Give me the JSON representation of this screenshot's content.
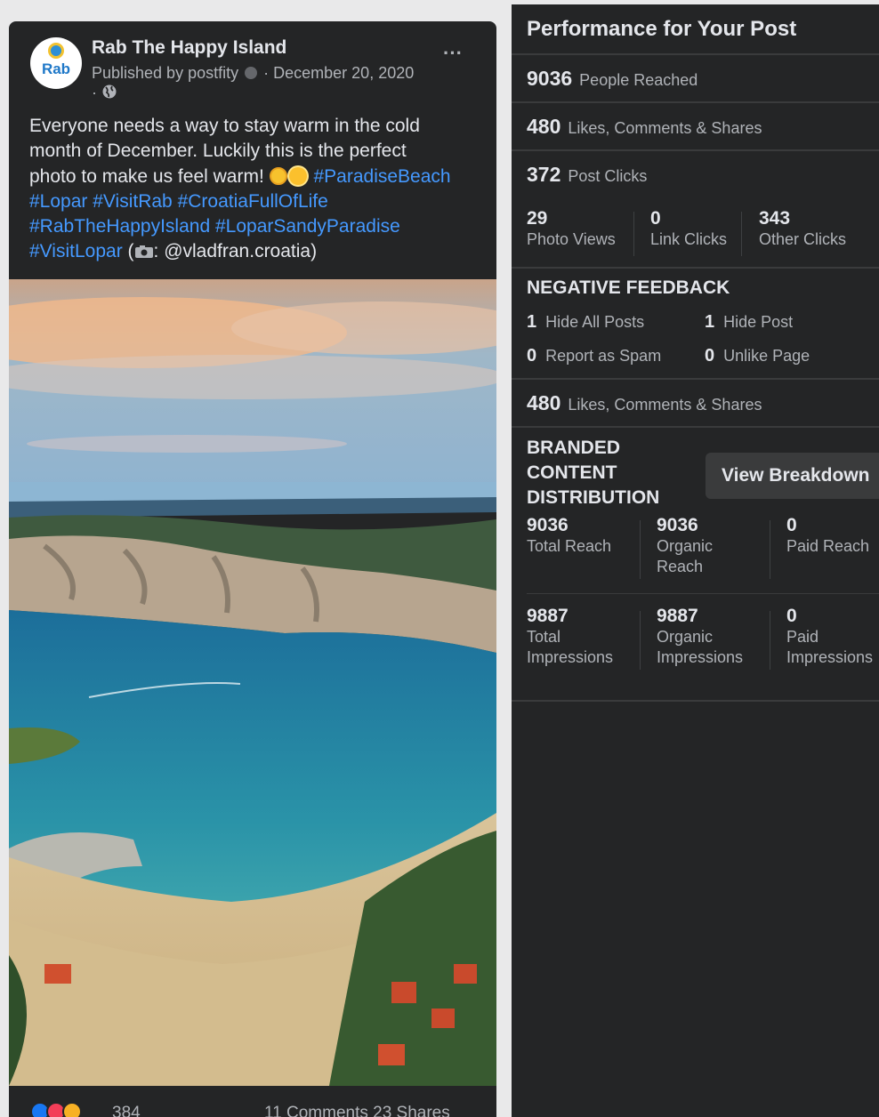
{
  "post": {
    "page_name": "Rab The Happy Island",
    "avatar_text": "Rab",
    "published_by": "Published by postfity",
    "date": "December 20, 2020",
    "separator": "·",
    "text_lines": [
      "Everyone needs a way to stay warm in the cold",
      "month of December. Luckily this is the perfect",
      "photo to make us feel warm!"
    ],
    "hashtags": {
      "paradise_beach": "#ParadiseBeach",
      "lopar": "#Lopar",
      "visit_rab": "#VisitRab",
      "croatia_full_of_life": "#CroatiaFullOfLife",
      "rab_the_happy_island": "#RabTheHappyIsland",
      "lopar_sandy_paradise": "#LoparSandyParadise",
      "visit_lopar": "#VisitLopar"
    },
    "credit_open": "(",
    "credit_handle": ": @vladfran.croatia)",
    "reaction_count": "384",
    "comments_shares": "11 Comments  23 Shares"
  },
  "insights": {
    "title": "Performance for Your Post",
    "people_reached": {
      "value": "9036",
      "label": "People Reached"
    },
    "engagement": {
      "value": "480",
      "label": "Likes, Comments & Shares"
    },
    "post_clicks": {
      "value": "372",
      "label": "Post Clicks"
    },
    "click_breakdown": [
      {
        "value": "29",
        "label": "Photo Views"
      },
      {
        "value": "0",
        "label": "Link Clicks"
      },
      {
        "value": "343",
        "label": "Other Clicks"
      }
    ],
    "negative_feedback": {
      "title": "NEGATIVE FEEDBACK",
      "items": [
        {
          "value": "1",
          "label": "Hide All Posts"
        },
        {
          "value": "1",
          "label": "Hide Post"
        },
        {
          "value": "0",
          "label": "Report as Spam"
        },
        {
          "value": "0",
          "label": "Unlike Page"
        }
      ]
    },
    "engagement_2": {
      "value": "480",
      "label": "Likes, Comments & Shares"
    },
    "branded": {
      "title_lines": [
        "BRANDED",
        "CONTENT",
        "DISTRIBUTION"
      ],
      "button": "View Breakdown",
      "reach": [
        {
          "value": "9036",
          "label_lines": [
            "Total Reach"
          ]
        },
        {
          "value": "9036",
          "label_lines": [
            "Organic",
            "Reach"
          ]
        },
        {
          "value": "0",
          "label_lines": [
            "Paid Reach"
          ]
        }
      ],
      "impressions": [
        {
          "value": "9887",
          "label_lines": [
            "Total",
            "Impressions"
          ]
        },
        {
          "value": "9887",
          "label_lines": [
            "Organic",
            "Impressions"
          ]
        },
        {
          "value": "0",
          "label_lines": [
            "Paid",
            "Impressions"
          ]
        }
      ]
    }
  }
}
